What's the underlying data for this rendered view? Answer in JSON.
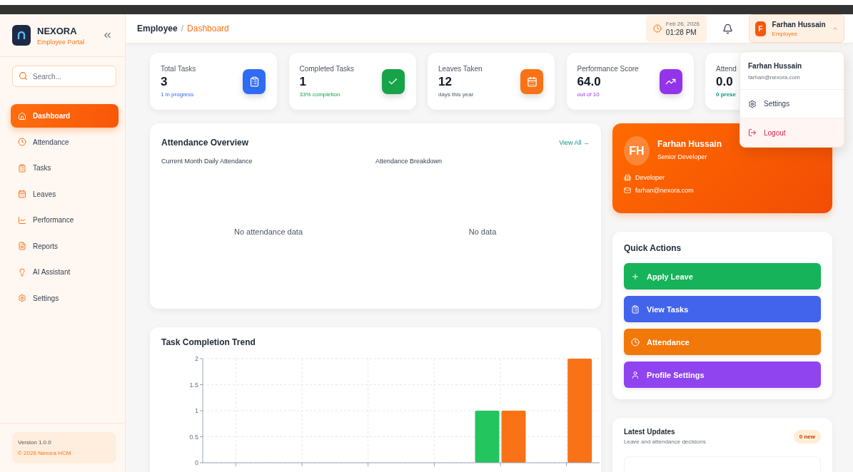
{
  "sidebar": {
    "brand": "NEXORA",
    "subtitle": "Employee Portal",
    "search": {
      "placeholder": "Search..."
    },
    "items": [
      {
        "label": "Dashboard",
        "selected": true
      },
      {
        "label": "Attendance",
        "selected": false
      },
      {
        "label": "Tasks",
        "selected": false
      },
      {
        "label": "Leaves",
        "selected": false
      },
      {
        "label": "Performance",
        "selected": false
      },
      {
        "label": "Reports",
        "selected": false
      },
      {
        "label": "AI Assistant",
        "selected": false
      },
      {
        "label": "Settings",
        "selected": false
      }
    ],
    "version": "Version 1.0.0",
    "copyright": "© 2026 Nexora HCM"
  },
  "header": {
    "breadcrumb": [
      "Employee",
      "/",
      "Dashboard"
    ],
    "date": "Feb 26, 2026",
    "time": "01:28 PM",
    "user": {
      "initial": "F",
      "name": "Farhan Hussain",
      "role": "Employee"
    }
  },
  "user_menu": {
    "name": "Farhan Hussain",
    "email": "farhan@nexora.com",
    "items": [
      {
        "label": "Settings",
        "kind": "settings"
      },
      {
        "label": "Logout",
        "kind": "logout"
      }
    ]
  },
  "stats": [
    {
      "label": "Total Tasks",
      "value": "3",
      "note": "1 in progress",
      "color": "#2f6bf6"
    },
    {
      "label": "Completed Tasks",
      "value": "1",
      "note": "33% completion",
      "color": "#16a34a"
    },
    {
      "label": "Leaves Taken",
      "value": "12",
      "note": "days this year",
      "color": "#f97316"
    },
    {
      "label": "Performance Score",
      "value": "64.0",
      "note": "out of 10",
      "color": "#9333ea"
    },
    {
      "label": "Attend",
      "value": "0.0",
      "note": "0 prese",
      "color": "#0d9488"
    }
  ],
  "attendance": {
    "title": "Attendance Overview",
    "link": "View All →",
    "left": {
      "title": "Current Month Daily Attendance",
      "empty": "No attendance data"
    },
    "right": {
      "title": "Attendance Breakdown",
      "empty": "No data"
    }
  },
  "trend": {
    "title": "Task Completion Trend",
    "chart_data": {
      "type": "bar",
      "grid": true,
      "ylim": [
        0,
        2
      ],
      "yticks": [
        0,
        0.5,
        1,
        1.5,
        2
      ],
      "series": [
        {
          "color": "#22c55e",
          "values": [
            0,
            0,
            0,
            0,
            1,
            0
          ]
        },
        {
          "color": "#f97316",
          "values": [
            0,
            0,
            0,
            0,
            1,
            2
          ]
        }
      ]
    }
  },
  "profile": {
    "initials": "FH",
    "name": "Farhan Hussain",
    "title": "Senior Developer",
    "role": "Developer",
    "email": "farhan@nexora.com"
  },
  "quick_actions": {
    "title": "Quick Actions",
    "items": [
      {
        "label": "Apply Leave",
        "color": "#16b35a"
      },
      {
        "label": "View Tasks",
        "color": "#4263eb"
      },
      {
        "label": "Attendance",
        "color": "#f2780a"
      },
      {
        "label": "Profile Settings",
        "color": "#8f44f0"
      }
    ]
  },
  "updates": {
    "title": "Latest Updates",
    "subtitle": "Leave and attendance decisions",
    "badge": "0 new"
  }
}
